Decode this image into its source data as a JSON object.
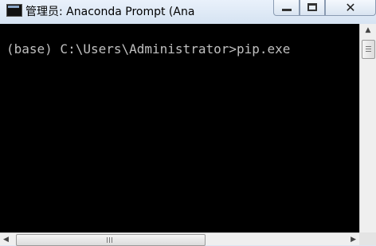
{
  "window": {
    "title": "管理员: Anaconda Prompt (Ana",
    "icon": "console-window-icon",
    "controls": {
      "minimize_icon": "minimize-icon",
      "maximize_icon": "maximize-icon",
      "close_glyph": "✕"
    }
  },
  "console": {
    "line": "(base) C:\\Users\\Administrator>pip.exe",
    "background": "#000000",
    "text_color": "#c0c0c0"
  },
  "scrollbars": {
    "left_arrow": "◀",
    "right_arrow": "▶",
    "up_arrow": "▲"
  }
}
